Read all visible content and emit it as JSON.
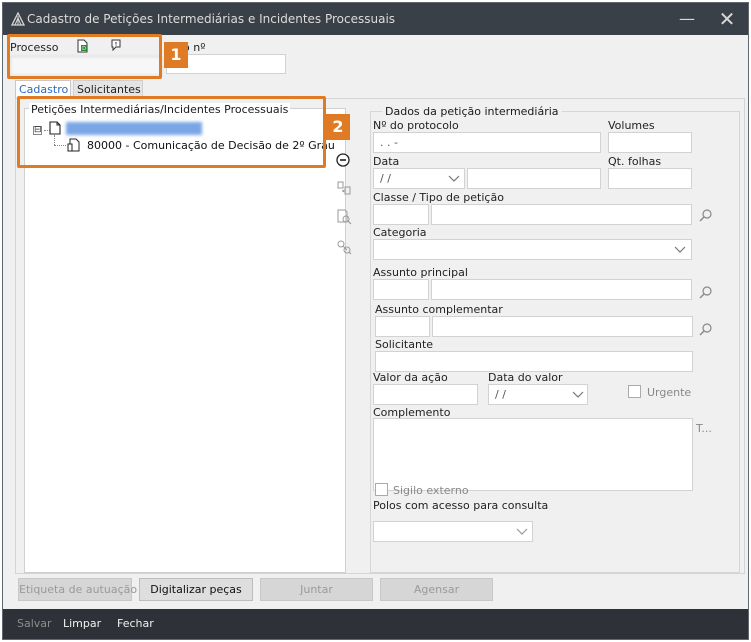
{
  "window": {
    "title": "Cadastro de Petições Intermediárias e Incidentes Processuais",
    "minimize_glyph": "—",
    "close_glyph": "✕"
  },
  "header": {
    "processo_label": "Processo",
    "numero_label": "o nº",
    "icons": [
      "document-d-icon",
      "speech-exclamation-icon"
    ]
  },
  "tabs": [
    {
      "label": "Cadastro",
      "active": true
    },
    {
      "label": "Solicitantes",
      "active": false
    }
  ],
  "tree": {
    "group_title": "Petições Intermediárias/Incidentes Processuais",
    "expander": "⊟",
    "child_label": "80000 - Comunicação de Decisão de 2º Grau"
  },
  "side_actions": [
    "minus-circle-icon",
    "transfer-document-icon",
    "search-document-icon",
    "key-search-icon"
  ],
  "form": {
    "group_title": "Dados da petição intermediária",
    "protocolo_label": "Nº do protocolo",
    "protocolo_value": ". .  -",
    "volumes_label": "Volumes",
    "data_label": "Data",
    "data_value": "/ /",
    "qt_folhas_label": "Qt. folhas",
    "classe_label": "Classe / Tipo de petição",
    "categoria_label": "Categoria",
    "assunto_principal_label": "Assunto principal",
    "assunto_complementar_label": "Assunto complementar",
    "solicitante_label": "Solicitante",
    "valor_acao_label": "Valor da ação",
    "data_valor_label": "Data do valor",
    "data_valor_value": "/ /",
    "urgente_label": "Urgente",
    "complemento_label": "Complemento",
    "complemento_more": "T...",
    "sigilo_label": "Sigilo externo",
    "polos_label": "Polos com acesso para consulta"
  },
  "buttons": {
    "etiqueta": "Etiqueta de autuação",
    "digitalizar": "Digitalizar peças",
    "juntar": "Juntar",
    "agensar": "Agensar"
  },
  "bottombar": {
    "salvar": "Salvar",
    "limpar": "Limpar",
    "fechar": "Fechar"
  },
  "annotations": [
    {
      "number": "1"
    },
    {
      "number": "2"
    }
  ],
  "colors": {
    "annotation": "#e07b25",
    "titlebar": "#3a4048",
    "bottombar": "#2e3238",
    "active_tab_text": "#2a6ac0"
  }
}
